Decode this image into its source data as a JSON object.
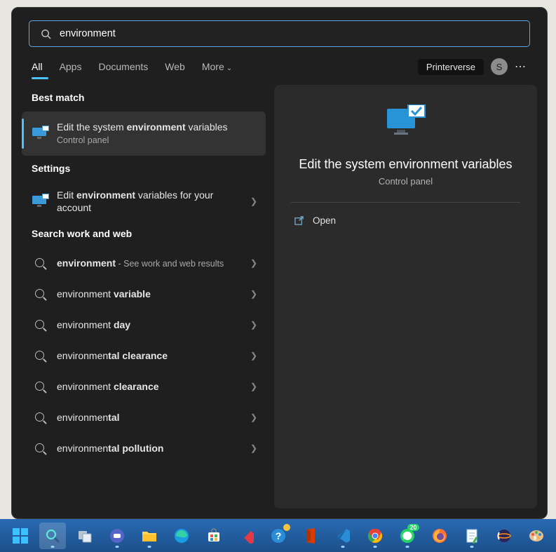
{
  "search": {
    "query": "environment"
  },
  "tabs": {
    "all": "All",
    "apps": "Apps",
    "documents": "Documents",
    "web": "Web",
    "more": "More"
  },
  "header": {
    "service_badge": "Printerverse",
    "avatar_initial": "S"
  },
  "sections": {
    "best_match": "Best match",
    "settings": "Settings",
    "search_web": "Search work and web"
  },
  "best_match": {
    "line_prefix": "Edit the system ",
    "line_bold": "environment",
    "line_suffix": " variables",
    "category": "Control panel"
  },
  "settings_item": {
    "prefix": "Edit ",
    "bold": "environment",
    "suffix": " variables for your account"
  },
  "web": {
    "r1_prefix": "environment",
    "r1_suffix": " - See work and web results",
    "r2_prefix": "environment ",
    "r2_bold": "variable",
    "r3_prefix": "environment ",
    "r3_bold": "day",
    "r4_prefix": "environmen",
    "r4_bold": "tal clearance",
    "r5_prefix": "environment ",
    "r5_bold": "clearance",
    "r6_prefix": "environmen",
    "r6_bold": "tal",
    "r7_prefix": "environmen",
    "r7_bold": "tal pollution"
  },
  "preview": {
    "title": "Edit the system environment variables",
    "subtitle": "Control panel",
    "open": "Open"
  },
  "taskbar": {
    "whatsapp_badge": "20"
  }
}
